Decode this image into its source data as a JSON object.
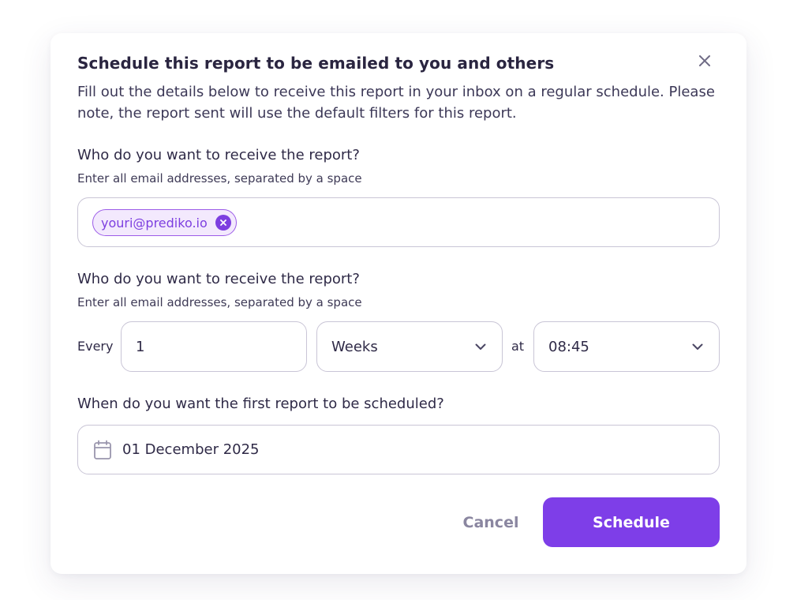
{
  "modal": {
    "title": "Schedule this report to be emailed to you and others",
    "description": "Fill out the details below to receive this report in your inbox on a regular schedule. Please note, the report sent will use the default filters for this report."
  },
  "recipients": {
    "label": "Who do you want to receive the report?",
    "hint": "Enter all email addresses, separated by a space",
    "emails": [
      "youri@prediko.io"
    ]
  },
  "frequency": {
    "label": "Who do you want to receive the report?",
    "hint": "Enter all email addresses, separated by a space",
    "every_label": "Every",
    "interval_value": "1",
    "unit_value": "Weeks",
    "at_label": "at",
    "time_value": "08:45"
  },
  "start_date": {
    "label": "When do you want the first report to be scheduled?",
    "value": "01 December 2025"
  },
  "actions": {
    "cancel_label": "Cancel",
    "schedule_label": "Schedule"
  },
  "icons": {
    "close": "close-icon",
    "chip_remove": "remove-chip-icon",
    "chevron": "chevron-down-icon",
    "calendar": "calendar-icon"
  },
  "colors": {
    "accent": "#7e3ee8",
    "chip_bg": "#f3e9fd",
    "text": "#2f2a47",
    "muted": "#8a86a0",
    "border": "#c9c5d6"
  }
}
